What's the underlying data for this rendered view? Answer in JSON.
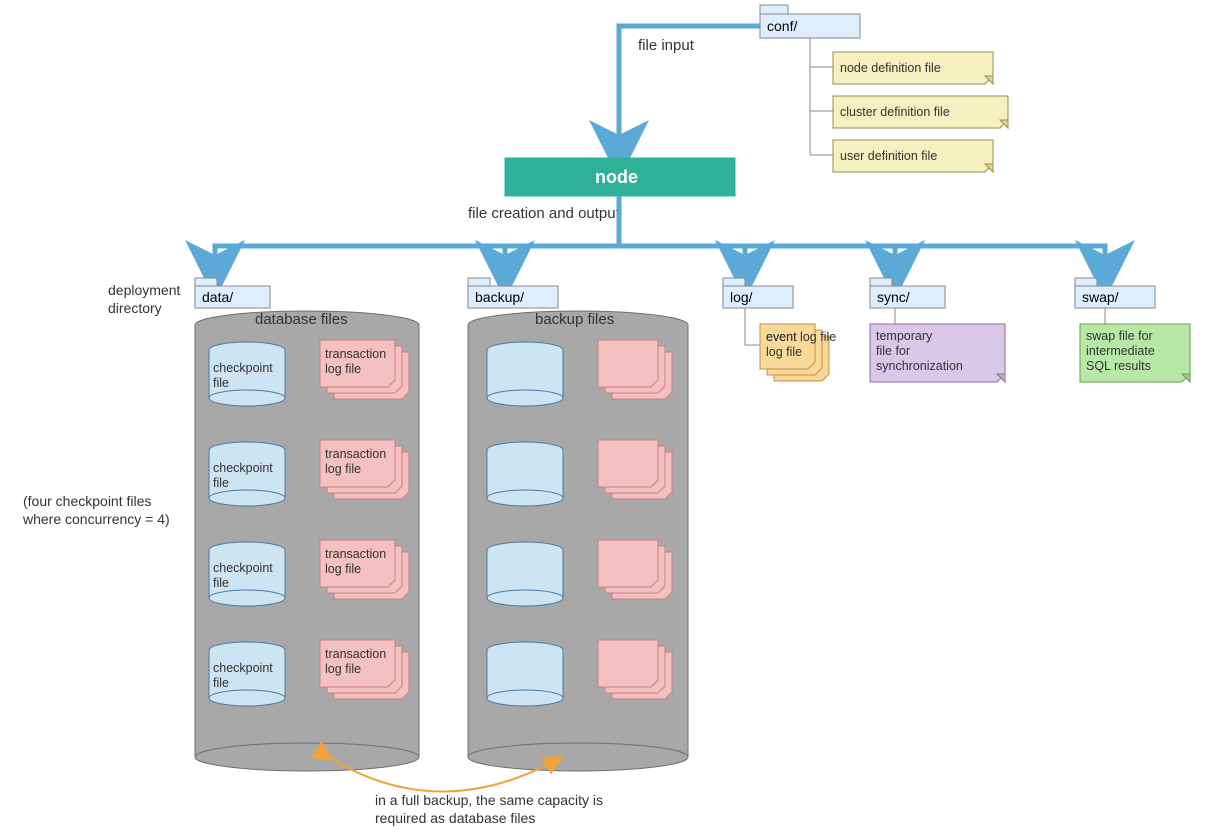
{
  "labels": {
    "file_input": "file input",
    "file_creation": "file creation and output",
    "node": "node",
    "deployment_directory1": "deployment",
    "deployment_directory2": "directory",
    "concurrency1": "(four checkpoint files",
    "concurrency2": "where concurrency = 4)",
    "backup_note1": "in a full backup, the same capacity is",
    "backup_note2": "required as database files",
    "database_files": "database files",
    "backup_files": "backup files"
  },
  "folders": {
    "conf": "conf/",
    "data": "data/",
    "backup": "backup/",
    "log": "log/",
    "sync": "sync/",
    "swap": "swap/"
  },
  "notes": {
    "node_def": "node definition file",
    "cluster_def": "cluster definition file",
    "user_def": "user definition file",
    "checkpoint": "checkpoint file",
    "txn_log": "transaction log file",
    "event_log": "event log file",
    "sync_temp": "temporary file for synchronization",
    "swap_file": "swap file for intermediate SQL results"
  }
}
